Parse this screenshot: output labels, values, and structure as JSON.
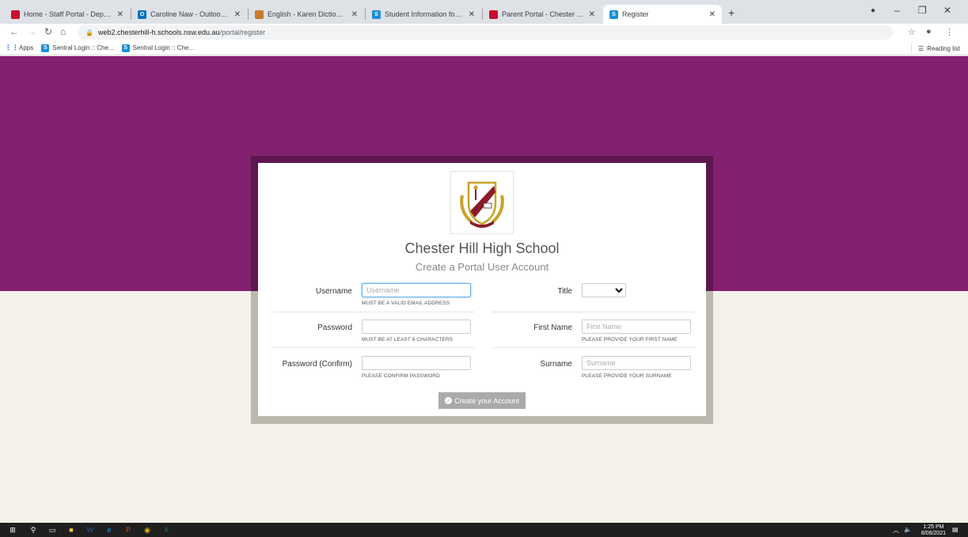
{
  "browser": {
    "tabs": [
      {
        "label": "Home - Staff Portal - Department",
        "icon_color": "#c8102e",
        "icon": "school-icon"
      },
      {
        "label": "Caroline Naw - Outlook Web App",
        "icon_color": "#0072c6",
        "icon": "outlook-icon"
      },
      {
        "label": "English - Karen Dictionary",
        "icon_color": "#c97b2a",
        "icon": "dictionary-icon"
      },
      {
        "label": "Student Information for Eevyan",
        "icon_color": "#1a8fd8",
        "icon": "sentral-icon"
      },
      {
        "label": "Parent Portal - Chester Hill High",
        "icon_color": "#c8102e",
        "icon": "school-icon"
      },
      {
        "label": "Register",
        "icon_color": "#1a8fd8",
        "icon": "sentral-icon"
      }
    ],
    "url_host": "web2.chesterhill-h.schools.nsw.edu.au",
    "url_path": "/portal/register",
    "bookmarks": [
      {
        "label": "Apps"
      },
      {
        "label": "Sentral Login :: Che..."
      },
      {
        "label": "Sentral Login :: Che..."
      }
    ],
    "reading_list": "Reading list"
  },
  "page": {
    "school_name": "Chester Hill High School",
    "subtitle": "Create a Portal User Account",
    "fields": {
      "username": {
        "label": "Username",
        "placeholder": "Username",
        "help": "MUST BE A VALID EMAIL ADDRESS"
      },
      "title": {
        "label": "Title"
      },
      "password": {
        "label": "Password",
        "help": "MUST BE AT LEAST 8 CHARACTERS"
      },
      "first_name": {
        "label": "First Name",
        "placeholder": "First Name",
        "help": "PLEASE PROVIDE YOUR FIRST NAME"
      },
      "password_confirm": {
        "label": "Password (Confirm)",
        "help": "PLEASE CONFIRM PASSWORD"
      },
      "surname": {
        "label": "Surname",
        "placeholder": "Surname",
        "help": "PLEASE PROVIDE YOUR SURNAME"
      }
    },
    "submit_label": "Create your Account"
  },
  "taskbar": {
    "time": "1:25 PM",
    "date": "8/06/2021"
  },
  "colors": {
    "brand_purple": "#82216f",
    "frame_dark": "#5e1650",
    "page_bg": "#f3f1ea"
  }
}
